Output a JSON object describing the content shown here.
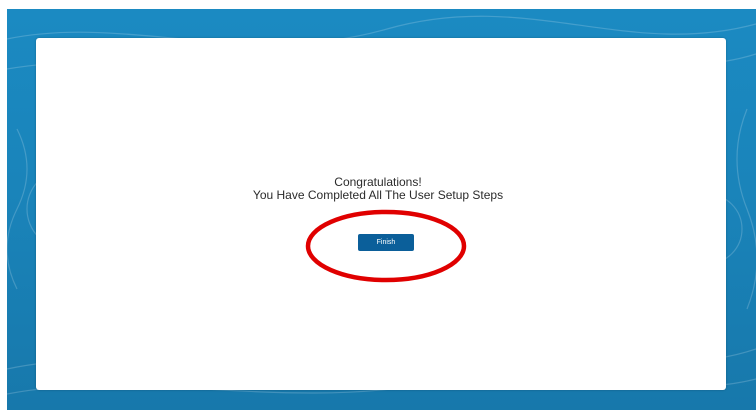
{
  "dialog": {
    "title": "Congratulations!",
    "subtitle": "You Have Completed All The User Setup Steps",
    "finish_label": "Finish"
  },
  "colors": {
    "background": "#1a84ba",
    "button": "#0b5f9a",
    "annotation_ring": "#e00000"
  }
}
